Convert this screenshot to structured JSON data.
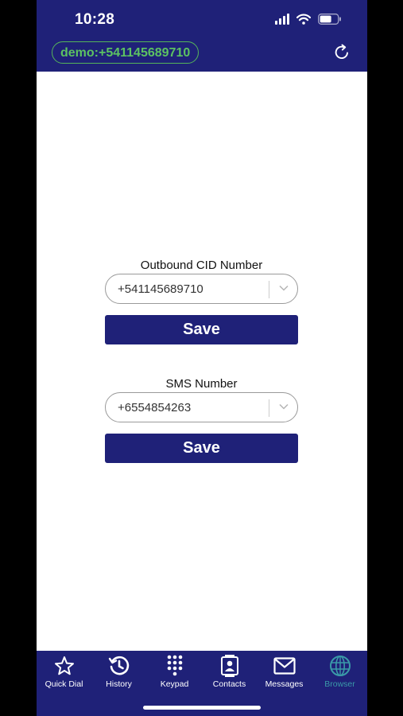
{
  "status_bar": {
    "time": "10:28"
  },
  "header": {
    "account": "demo:+541145689710",
    "refresh_icon": "refresh-icon"
  },
  "outbound": {
    "label": "Outbound CID Number",
    "value": "+541145689710",
    "save_label": "Save"
  },
  "sms": {
    "label": "SMS Number",
    "value": "+6554854263",
    "save_label": "Save"
  },
  "tabs": [
    {
      "label": "Quick Dial",
      "icon": "star-icon"
    },
    {
      "label": "History",
      "icon": "history-icon"
    },
    {
      "label": "Keypad",
      "icon": "keypad-icon"
    },
    {
      "label": "Contacts",
      "icon": "contacts-icon"
    },
    {
      "label": "Messages",
      "icon": "envelope-icon"
    },
    {
      "label": "Browser",
      "icon": "globe-icon",
      "active": true
    }
  ],
  "colors": {
    "brand": "#1f2178",
    "accent_green": "#5cc262",
    "active_tab": "#3a9aa8"
  }
}
